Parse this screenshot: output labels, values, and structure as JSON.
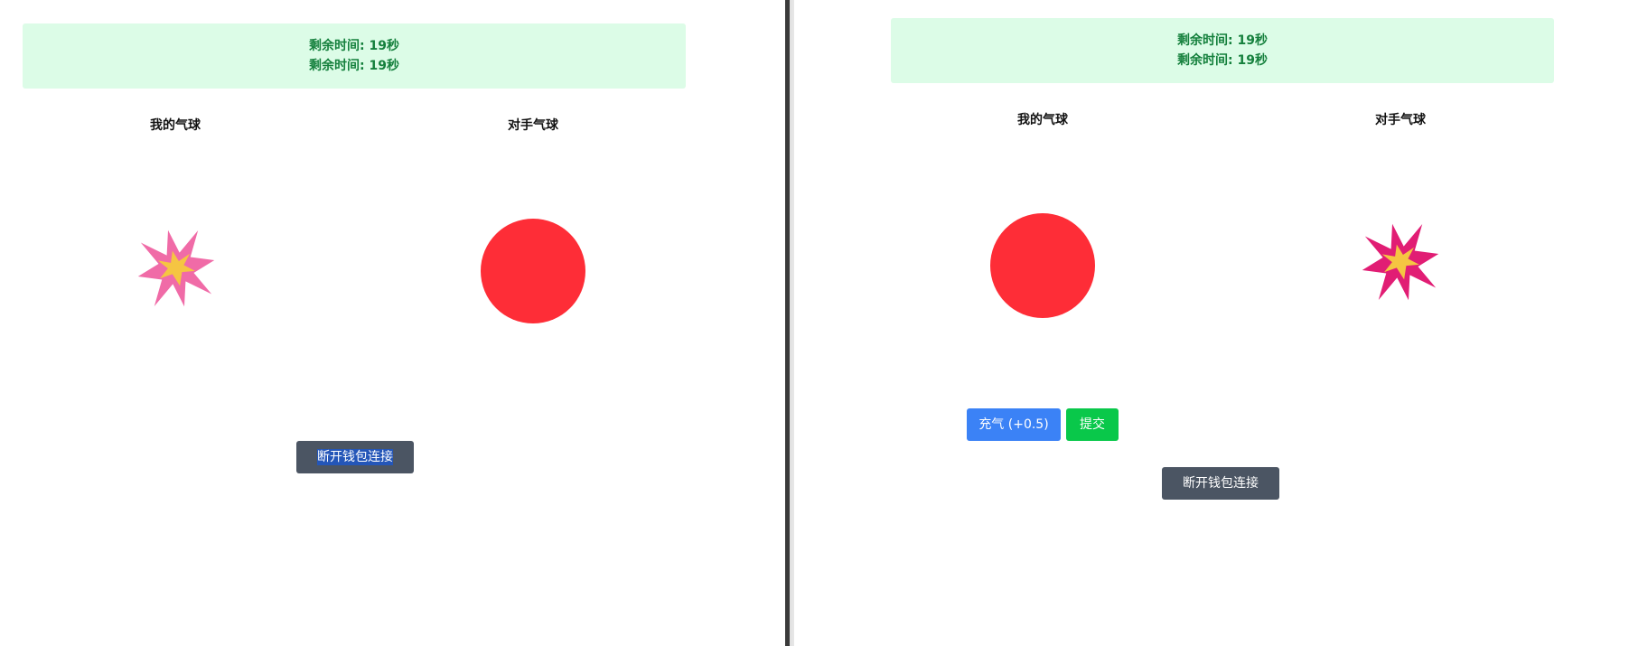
{
  "left_window": {
    "status": {
      "line1": "剩余时间: 19秒",
      "line2": "剩余时间: 19秒"
    },
    "my_balloon_label": "我的气球",
    "opponent_balloon_label": "对手气球",
    "my_balloon_state": "burst",
    "opponent_balloon_state": "inflated",
    "disconnect_button": "断开钱包连接"
  },
  "right_window": {
    "status": {
      "line1": "剩余时间: 19秒",
      "line2": "剩余时间: 19秒"
    },
    "my_balloon_label": "我的气球",
    "opponent_balloon_label": "对手气球",
    "my_balloon_state": "inflated",
    "opponent_balloon_state": "burst",
    "inflate_button": "充气 (+0.5)",
    "submit_button": "提交",
    "disconnect_button": "断开钱包连接"
  },
  "colors": {
    "status_bg": "#dcfce7",
    "status_text": "#15803d",
    "balloon": "#fe2d37",
    "burst_left": "#f06ba7",
    "burst_right": "#e11d74",
    "burst_core": "#f5c542",
    "button_dark": "#4b5563",
    "button_blue": "#3b82f6",
    "button_green": "#09c84a"
  }
}
